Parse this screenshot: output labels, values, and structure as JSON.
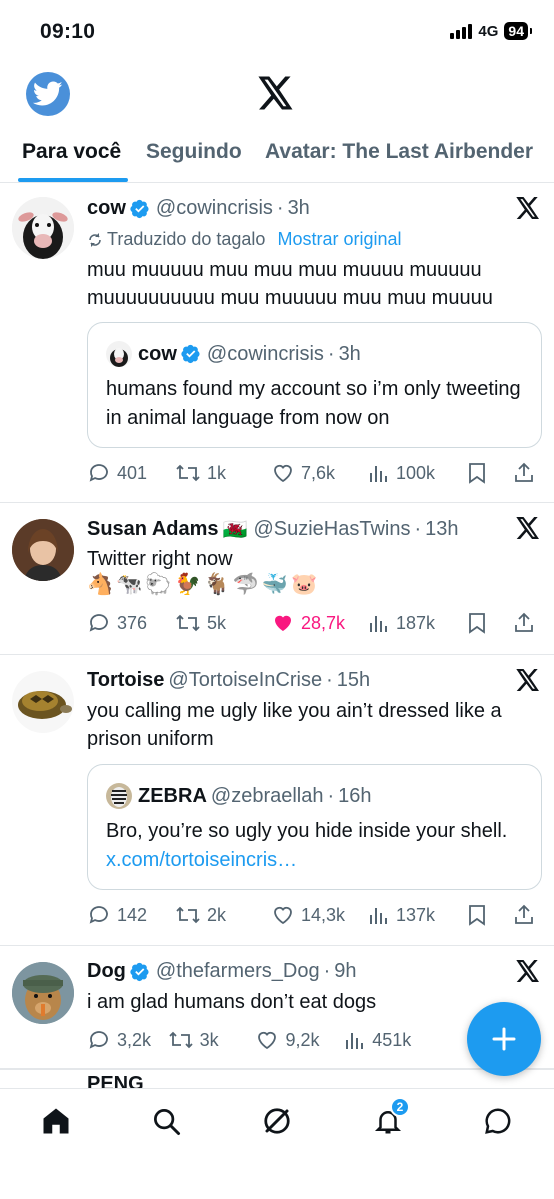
{
  "status_bar": {
    "time": "09:10",
    "network": "4G",
    "battery": "94"
  },
  "header": {
    "logo_icon": "x-logo-icon",
    "avatar_icon": "twitter-bird-icon"
  },
  "tabs": [
    {
      "label": "Para você",
      "active": true
    },
    {
      "label": "Seguindo",
      "active": false
    },
    {
      "label": "Avatar: The Last Airbender",
      "active": false
    }
  ],
  "tweets": [
    {
      "name": "cow",
      "verified": true,
      "handle": "@cowincrisis",
      "time": "3h",
      "translation_note": "Traduzido do tagalo",
      "show_original": "Mostrar original",
      "text": "muu muuuuu muu muu muu muuuu muuuuu muuuuuuuuuu muu muuuuu muu muu muuuu",
      "quote": {
        "name": "cow",
        "verified": true,
        "handle": "@cowincrisis",
        "time": "3h",
        "text": "humans found my account so i’m only tweeting in animal language from now on"
      },
      "replies": "401",
      "retweets": "1k",
      "likes": "7,6k",
      "views": "100k"
    },
    {
      "name": "Susan Adams",
      "flag": "🏴󠁧󠁢󠁷󠁬󠁳󠁿",
      "handle": "@SuzieHasTwins",
      "time": "13h",
      "text": "Twitter right now",
      "emojis": "🐴🐄🐑🐓🐐🦈🐳🐷",
      "replies": "376",
      "retweets": "5k",
      "likes": "28,7k",
      "views": "187k",
      "liked": true
    },
    {
      "name": "Tortoise",
      "handle": "@TortoiseInCrise",
      "time": "15h",
      "text": "you calling me ugly like you ain’t dressed like a prison uniform",
      "quote": {
        "name": "ZEBRA",
        "handle": "@zebraellah",
        "time": "16h",
        "text": "Bro, you’re so ugly you hide inside your shell.",
        "link": "x.com/tortoiseincris…"
      },
      "replies": "142",
      "retweets": "2k",
      "likes": "14,3k",
      "views": "137k"
    },
    {
      "name": "Dog",
      "verified": true,
      "handle": "@thefarmers_Dog",
      "time": "9h",
      "text": "i am glad humans don’t eat dogs",
      "replies": "3,2k",
      "retweets": "3k",
      "likes": "9,2k",
      "views": "451k"
    }
  ],
  "partial_tweet": {
    "name": "PENG"
  },
  "bottom_nav": {
    "items": [
      "home-icon",
      "search-icon",
      "grok-icon",
      "notifications-icon",
      "messages-icon"
    ],
    "notification_count": "2"
  },
  "colors": {
    "accent": "#1d9bf0",
    "like": "#f91880",
    "text": "#0f1419",
    "secondary": "#536471"
  }
}
